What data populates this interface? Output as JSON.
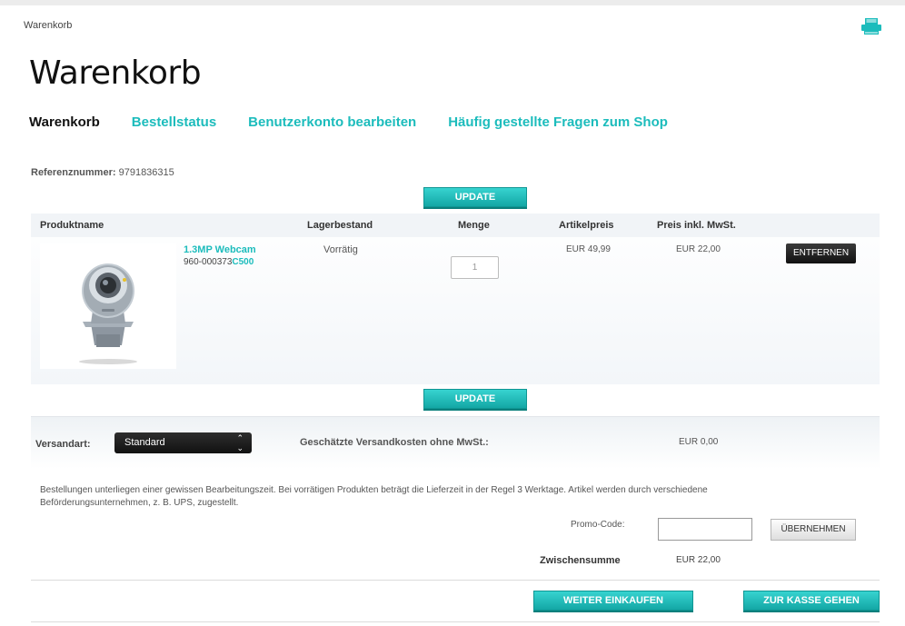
{
  "breadcrumb": "Warenkorb",
  "page_title": "Warenkorb",
  "nav": {
    "current": "Warenkorb",
    "order_status": "Bestellstatus",
    "edit_account": "Benutzerkonto bearbeiten",
    "faq": "Häufig gestellte Fragen zum Shop"
  },
  "reference": {
    "label": "Referenznummer:",
    "value": "9791836315"
  },
  "update_label": "UPDATE",
  "table": {
    "headers": {
      "product": "Produktname",
      "stock": "Lagerbestand",
      "quantity": "Menge",
      "unit_price": "Artikelpreis",
      "total_price": "Preis inkl. MwSt."
    },
    "item": {
      "name": "1.3MP Webcam",
      "sku_number": "960-000373",
      "sku_model": "C500",
      "stock": "Vorrätig",
      "quantity": "1",
      "unit_price": "EUR 49,99",
      "total_price": "EUR 22,00",
      "remove_label": "ENTFERNEN"
    }
  },
  "shipping": {
    "label": "Versandart:",
    "selected": "Standard",
    "cost_label": "Geschätzte Versandkosten ohne MwSt.:",
    "cost": "EUR 0,00"
  },
  "notice": "Bestellungen unterliegen einer gewissen Bearbeitungszeit. Bei vorrätigen Produkten beträgt die Lieferzeit in der Regel 3 Werktage. Artikel werden durch verschiedene Beförderungsunternehmen, z. B. UPS, zugestellt.",
  "promo": {
    "label": "Promo-Code:",
    "value": "",
    "apply_label": "ÜBERNEHMEN"
  },
  "subtotal": {
    "label": "Zwischensumme",
    "value": "EUR 22,00"
  },
  "buttons": {
    "continue_shopping": "WEITER EINKAUFEN",
    "checkout": "ZUR KASSE GEHEN"
  },
  "colors": {
    "accent": "#1cbcbc",
    "dark_button": "#1a1a1a"
  },
  "icons": {
    "print": "printer-icon",
    "select_arrows": "chevron-up-down-icon"
  }
}
